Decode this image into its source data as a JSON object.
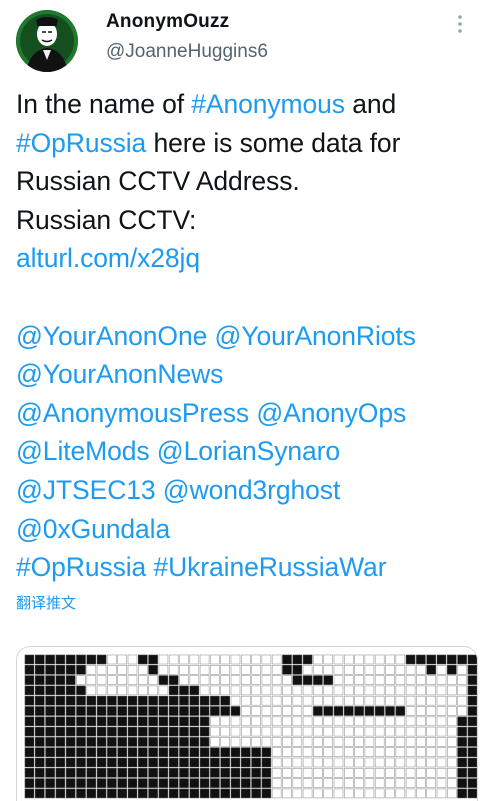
{
  "author": {
    "display_name": "AnonymOuzz",
    "handle": "@JoanneHuggins6",
    "avatar_icon": "anonymous-mask-icon",
    "avatar_color": "#1f7a2f"
  },
  "menu_icon": "more-vertical-icon",
  "tweet": {
    "line_1_text": "In the name of ",
    "line_1_tag": "#Anonymous",
    "line_1_suffix": " and",
    "line_2_tag": "#OpRussia",
    "line_2_text": " here is some data for",
    "line_3_text": "Russian CCTV Address.",
    "line_4_text": "Russian CCTV:",
    "link_url": "alturl.com/x28jq",
    "mentions_1a": "@YourAnonOne",
    "mentions_1b": "@YourAnonRiots",
    "mentions_2a": "@YourAnonNews",
    "mentions_3a": "@AnonymousPress",
    "mentions_3b": "@AnonyOps",
    "mentions_4a": "@LiteMods",
    "mentions_4b": "@LorianSynaro",
    "mentions_5a": "@JTSEC13",
    "mentions_5b": "@wond3rghost",
    "mentions_6a": "@0xGundala",
    "hashtags_a": "#OpRussia",
    "hashtags_b": "#UkraineRussiaWar"
  },
  "translate_label": "翻译推文",
  "colors": {
    "link": "#1d9bf0",
    "text": "#0f1419",
    "muted": "#536471"
  }
}
